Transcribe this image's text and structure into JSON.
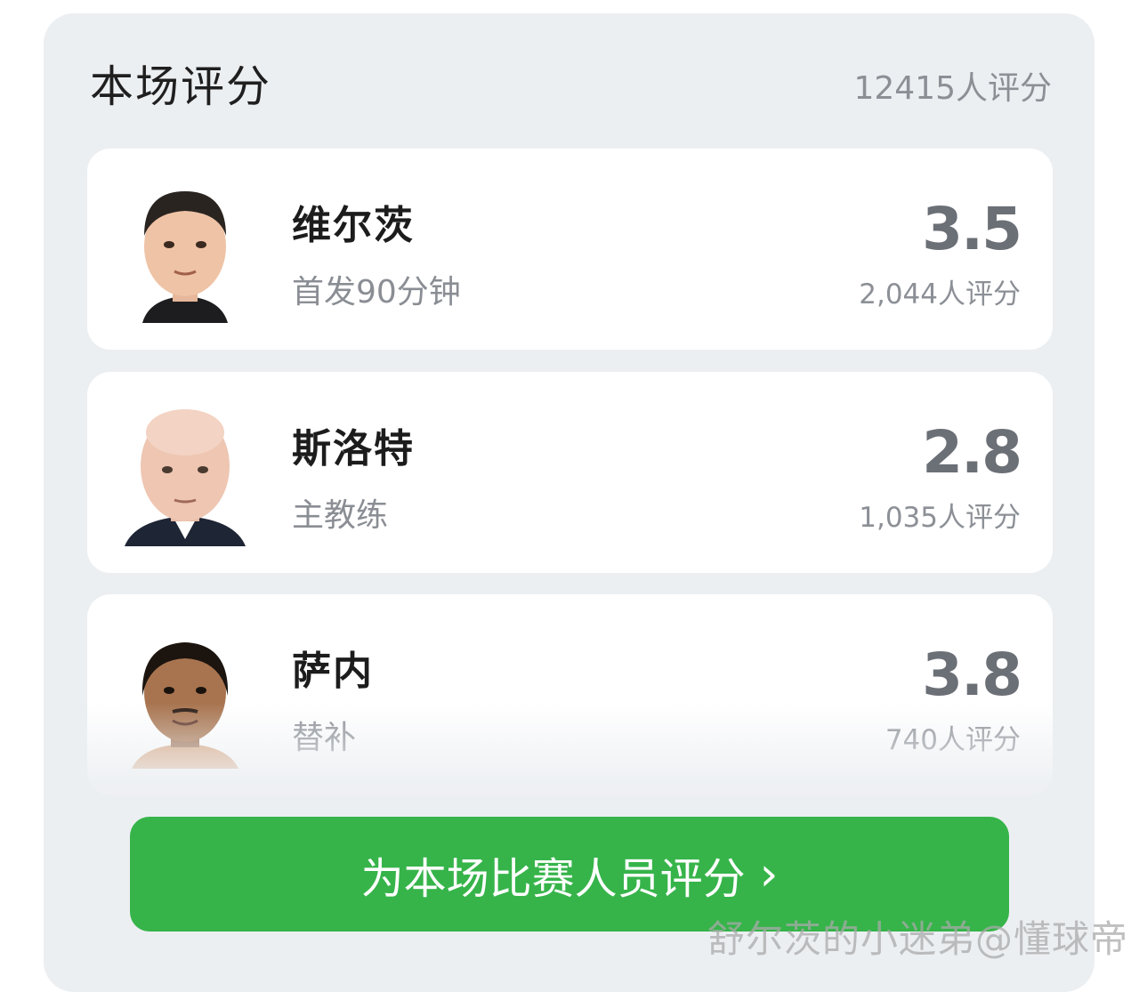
{
  "section": {
    "title": "本场评分",
    "total_count": "12415人评分"
  },
  "people": [
    {
      "name": "维尔茨",
      "role": "首发90分钟",
      "score": "3.5",
      "raters": "2,044人评分",
      "avatar_icon": "player-photo"
    },
    {
      "name": "斯洛特",
      "role": "主教练",
      "score": "2.8",
      "raters": "1,035人评分",
      "avatar_icon": "coach-photo"
    },
    {
      "name": "萨内",
      "role": "替补",
      "score": "3.8",
      "raters": "740人评分",
      "avatar_icon": "player-photo"
    }
  ],
  "cta": {
    "label": "为本场比赛人员评分",
    "icon": "chevron-right-icon",
    "color": "#36b44a"
  },
  "watermark": "舒尔茨的小迷弟@懂球帝"
}
